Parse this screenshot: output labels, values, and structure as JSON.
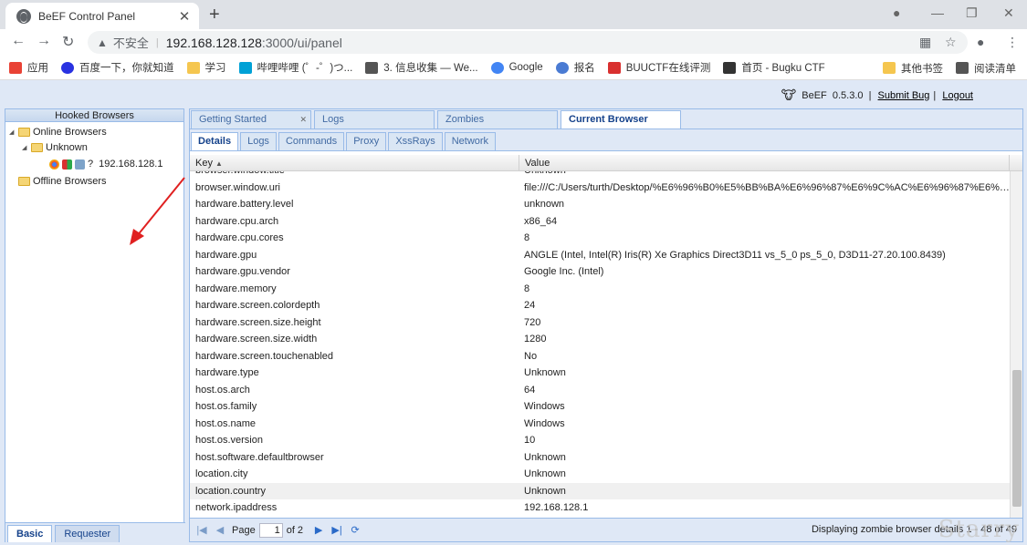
{
  "browser": {
    "tab_title": "BeEF Control Panel",
    "insecure_label": "不安全",
    "url_host": "192.168.128.128",
    "url_path": ":3000/ui/panel",
    "bookmarks": [
      {
        "label": "应用",
        "color": "#e94235"
      },
      {
        "label": "百度一下，你就知道",
        "color": "#2932e1"
      },
      {
        "label": "学习",
        "color": "#f5c64f"
      },
      {
        "label": "哔哩哔哩 (゜-゜)つ...",
        "color": "#00a1d6"
      },
      {
        "label": "3. 信息收集 — We...",
        "color": "#555555"
      },
      {
        "label": "Google",
        "color": "#4285f4"
      },
      {
        "label": "报名",
        "color": "#4a7bd3"
      },
      {
        "label": "BUUCTF在线评测",
        "color": "#d9302f"
      },
      {
        "label": "首页 - Bugku CTF",
        "color": "#333333"
      }
    ],
    "bookmarks_right": [
      {
        "label": "其他书签",
        "color": "#f5c64f"
      },
      {
        "label": "阅读清单",
        "color": "#555555"
      }
    ]
  },
  "beef": {
    "name": "BeEF",
    "version": "0.5.3.0",
    "submit_bug": "Submit Bug",
    "logout": "Logout"
  },
  "left_panel": {
    "title": "Hooked Browsers",
    "online": "Online Browsers",
    "unknown": "Unknown",
    "browser_ip": "192.168.128.1",
    "unknown_os": "?",
    "offline": "Offline Browsers",
    "tabs": [
      "Basic",
      "Requester"
    ]
  },
  "main_tabs": [
    "Getting Started",
    "Logs",
    "Zombies",
    "Current Browser"
  ],
  "sub_tabs": [
    "Details",
    "Logs",
    "Commands",
    "Proxy",
    "XssRays",
    "Network"
  ],
  "grid": {
    "col_key": "Key",
    "col_value": "Value",
    "rows": [
      {
        "key": "browser.window.title",
        "value": "Unknown"
      },
      {
        "key": "browser.window.uri",
        "value": "file:///C:/Users/turth/Desktop/%E6%96%B0%E5%BB%BA%E6%96%87%E6%9C%AC%E6%96%87%E6%A1..."
      },
      {
        "key": "hardware.battery.level",
        "value": "unknown"
      },
      {
        "key": "hardware.cpu.arch",
        "value": "x86_64"
      },
      {
        "key": "hardware.cpu.cores",
        "value": "8"
      },
      {
        "key": "hardware.gpu",
        "value": "ANGLE (Intel, Intel(R) Iris(R) Xe Graphics Direct3D11 vs_5_0 ps_5_0, D3D11-27.20.100.8439)"
      },
      {
        "key": "hardware.gpu.vendor",
        "value": "Google Inc. (Intel)"
      },
      {
        "key": "hardware.memory",
        "value": "8"
      },
      {
        "key": "hardware.screen.colordepth",
        "value": "24"
      },
      {
        "key": "hardware.screen.size.height",
        "value": "720"
      },
      {
        "key": "hardware.screen.size.width",
        "value": "1280"
      },
      {
        "key": "hardware.screen.touchenabled",
        "value": "No"
      },
      {
        "key": "hardware.type",
        "value": "Unknown"
      },
      {
        "key": "host.os.arch",
        "value": "64"
      },
      {
        "key": "host.os.family",
        "value": "Windows"
      },
      {
        "key": "host.os.name",
        "value": "Windows"
      },
      {
        "key": "host.os.version",
        "value": "10"
      },
      {
        "key": "host.software.defaultbrowser",
        "value": "Unknown"
      },
      {
        "key": "location.city",
        "value": "Unknown"
      },
      {
        "key": "location.country",
        "value": "Unknown"
      },
      {
        "key": "network.ipaddress",
        "value": "192.168.128.1"
      }
    ]
  },
  "pager": {
    "page_label": "Page",
    "page": "1",
    "of_label": "of 2",
    "displaying": "Displaying zombie browser details 1 - 48 of 49"
  },
  "watermark": "Starry"
}
